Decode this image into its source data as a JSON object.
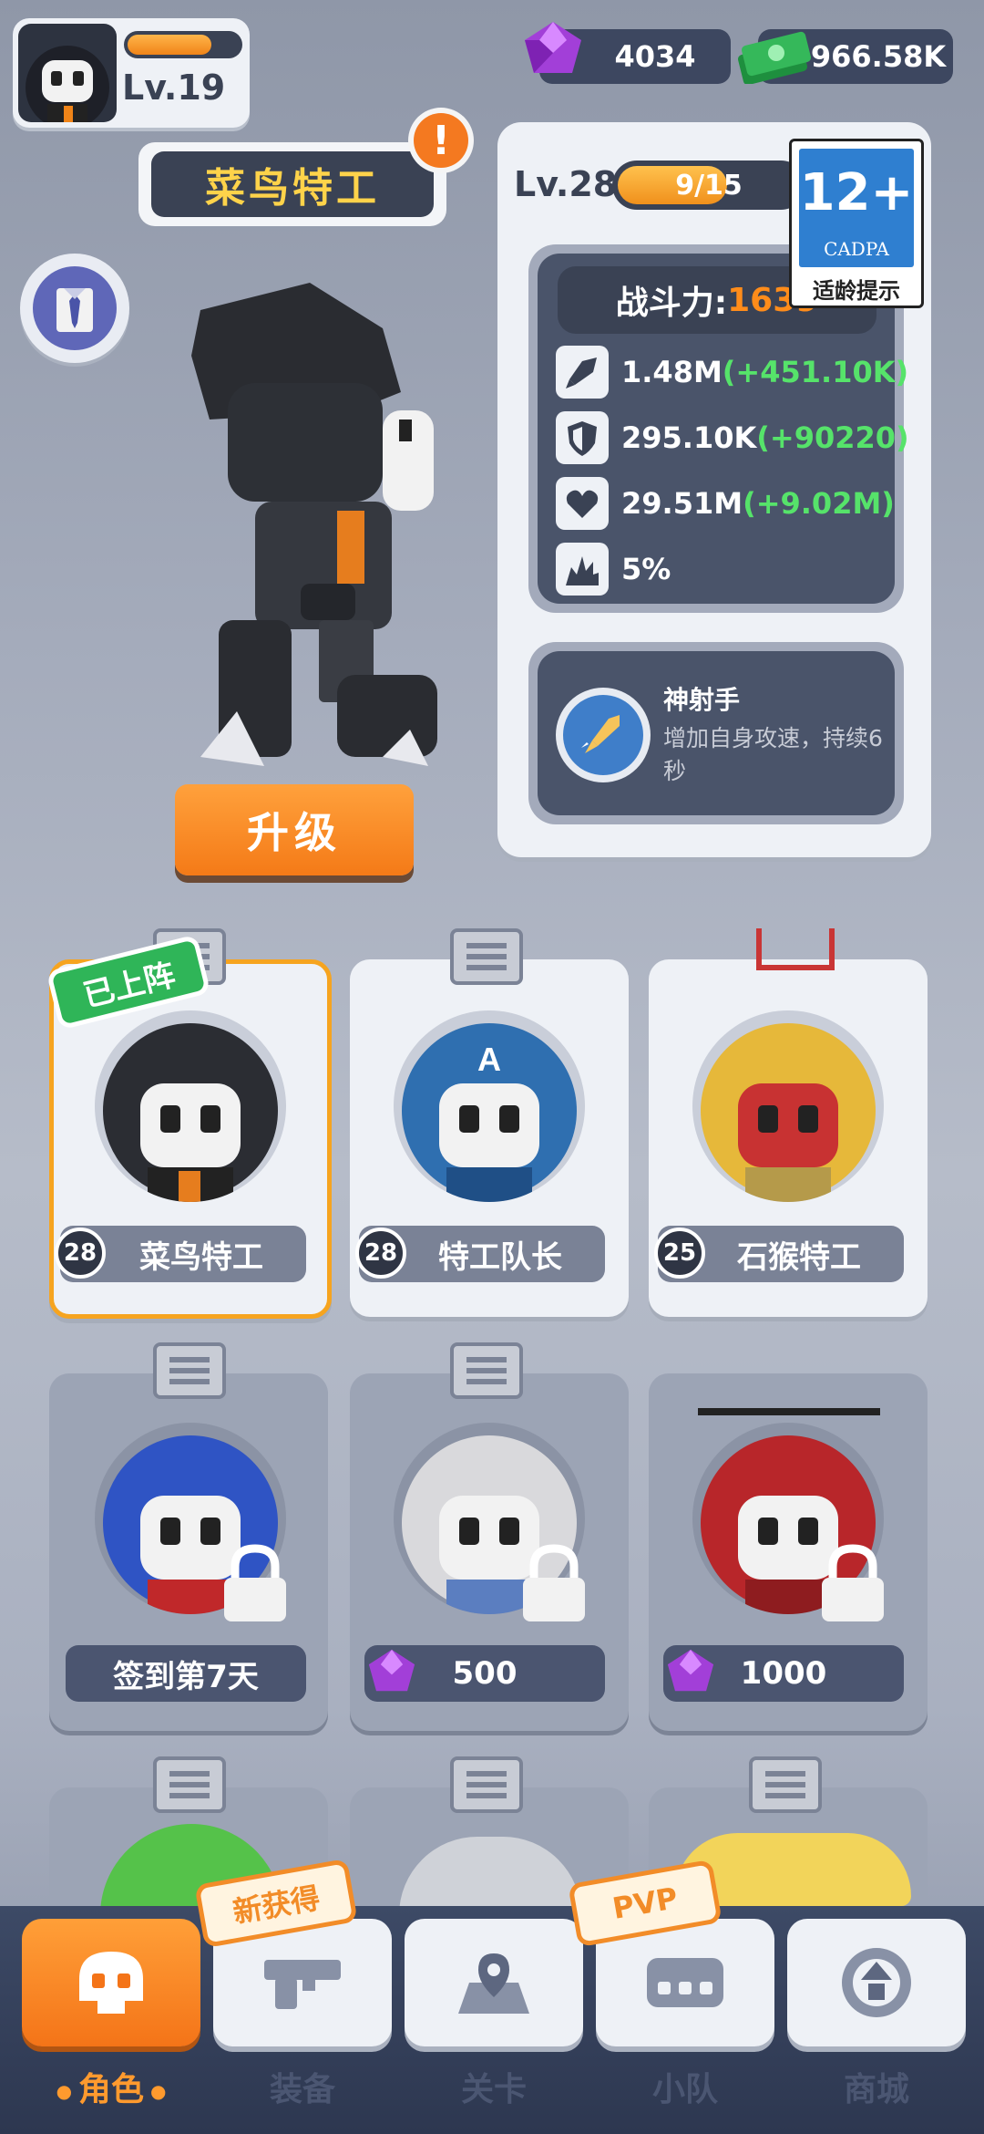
{
  "player": {
    "level": "Lv.19",
    "xp_fraction": 0.75
  },
  "currency": {
    "gems": "4034",
    "cash": "966.58K"
  },
  "hero": {
    "name": "菜鸟特工",
    "alert": "!",
    "level": "Lv.28",
    "xp_text": "9/15",
    "xp_fraction": 0.6,
    "power_label": "战斗力:",
    "power_value": "1639",
    "stats": [
      {
        "icon": "bullet-icon",
        "value": "1.48M",
        "bonus": "(+451.10K)"
      },
      {
        "icon": "shield-icon",
        "value": "295.10K",
        "bonus": "(+90220)"
      },
      {
        "icon": "heart-icon",
        "value": "29.51M",
        "bonus": "(+9.02M)"
      },
      {
        "icon": "crit-icon",
        "value": "5%",
        "bonus": ""
      }
    ],
    "skill": {
      "name": "神射手",
      "desc": "增加自身攻速，持续6秒"
    },
    "upgrade_label": "升级"
  },
  "age_rating": {
    "number": "12+",
    "org": "CADPA",
    "label": "适龄提示"
  },
  "deployed_tag": "已上阵",
  "cards": [
    {
      "name": "菜鸟特工",
      "level": "28",
      "color": "#2b2d33",
      "state": "owned",
      "selected": true
    },
    {
      "name": "特工队长",
      "level": "28",
      "color": "#2f6fb0",
      "state": "owned",
      "selected": false
    },
    {
      "name": "石猴特工",
      "level": "25",
      "color": "#e6b83a",
      "state": "owned",
      "selected": false
    },
    {
      "name": "签到第7天",
      "price": "",
      "color": "#2f54c4",
      "state": "locked"
    },
    {
      "name": "",
      "price": "500",
      "color": "#d9d9dc",
      "state": "locked"
    },
    {
      "name": "",
      "price": "1000",
      "color": "#b8262a",
      "state": "locked"
    }
  ],
  "nav": {
    "items": [
      {
        "label": "角色",
        "active": true
      },
      {
        "label": "装备",
        "active": false
      },
      {
        "label": "关卡",
        "active": false
      },
      {
        "label": "小队",
        "active": false
      },
      {
        "label": "商城",
        "active": false
      }
    ],
    "tag_new": "新获得",
    "tag_pvp": "PVP"
  },
  "colors": {
    "accent_orange": "#f47a17",
    "bonus_green": "#56e36a",
    "power_orange": "#ff8c1a",
    "panel_dark": "#4a546a"
  }
}
